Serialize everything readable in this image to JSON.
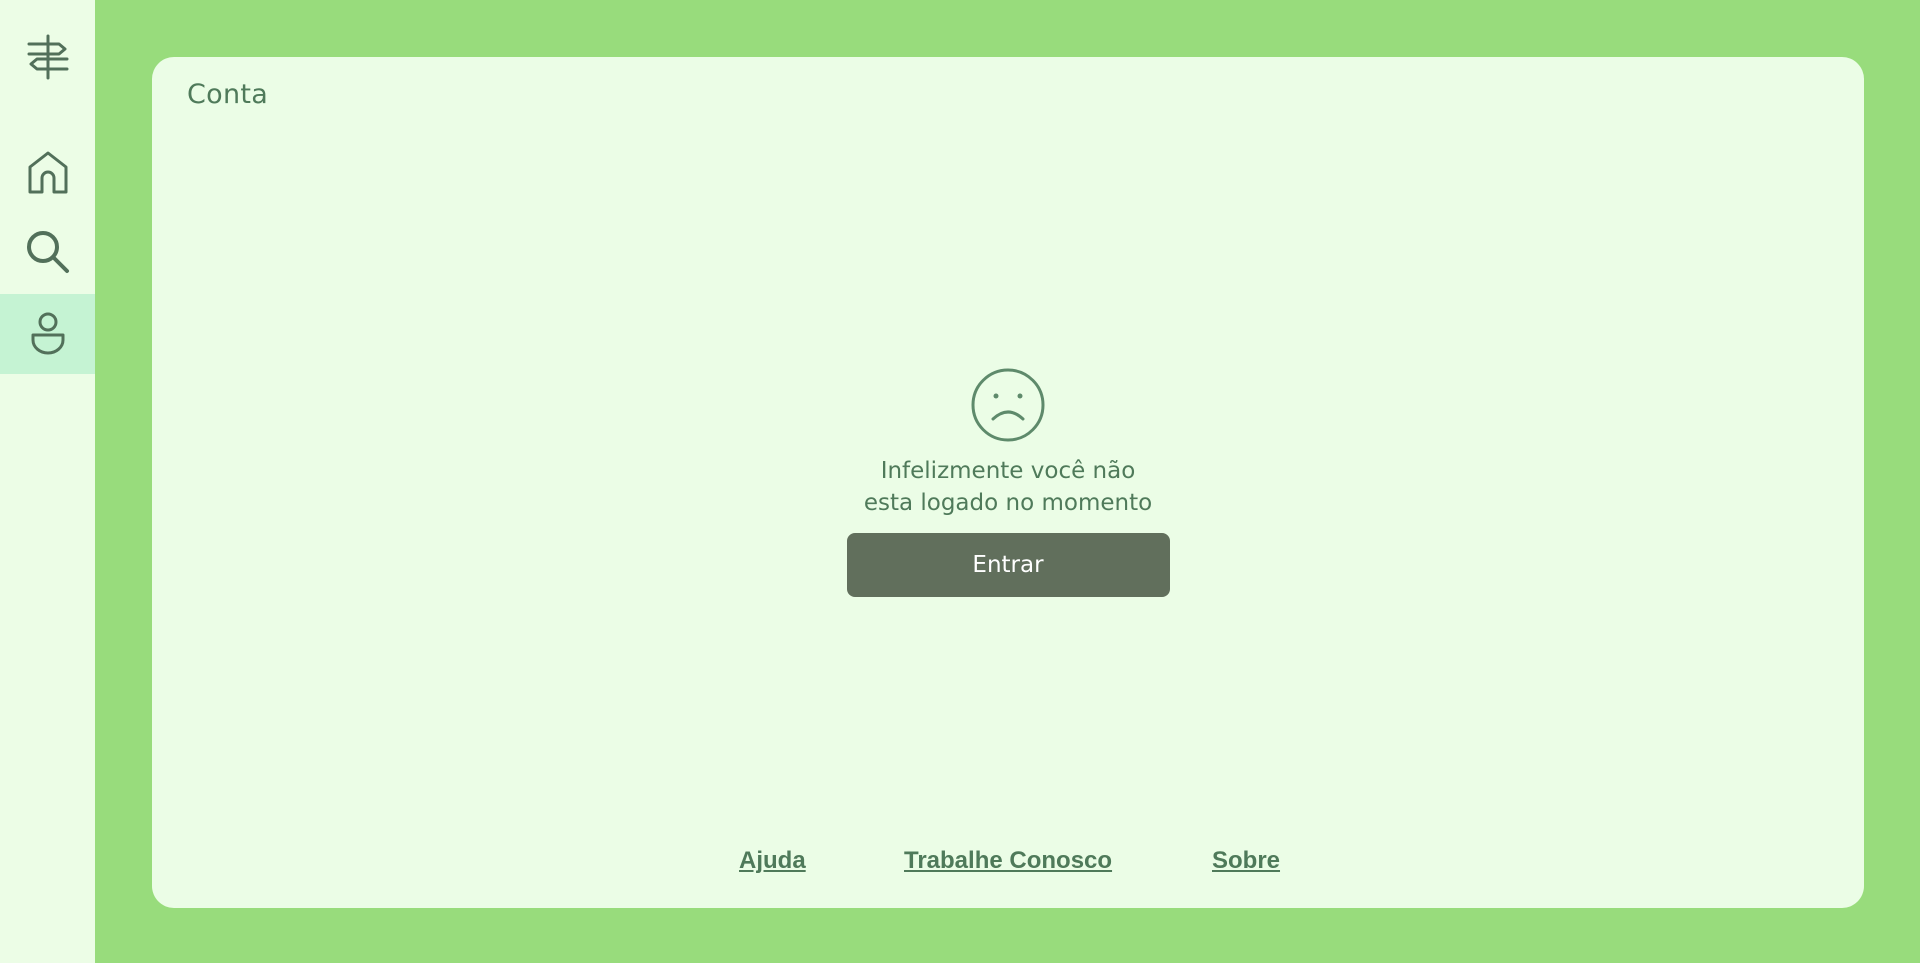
{
  "sidebar": {
    "logo_icon": "signpost-icon",
    "items": [
      {
        "name": "home",
        "icon": "home-icon",
        "active": false
      },
      {
        "name": "search",
        "icon": "search-icon",
        "active": false
      },
      {
        "name": "account",
        "icon": "user-icon",
        "active": true
      }
    ]
  },
  "page": {
    "title": "Conta"
  },
  "empty_state": {
    "icon": "sad-face-icon",
    "message": "Infelizmente você não\nesta logado no momento",
    "button_label": "Entrar"
  },
  "footer": {
    "links": [
      "Ajuda",
      "Trabalhe Conosco",
      "Sobre"
    ]
  },
  "colors": {
    "background": "#98dc7c",
    "sidebar": "#ecfde6",
    "card": "#ebfde6",
    "active_nav": "#c5f3d3",
    "text": "#4f7a5a",
    "button": "#616f5c"
  }
}
